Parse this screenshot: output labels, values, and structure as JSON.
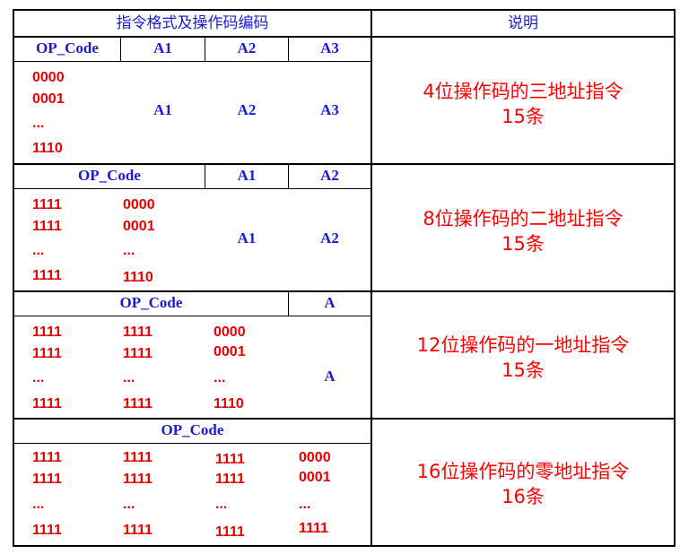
{
  "header": {
    "format_title": "指令格式及操作码编码",
    "desc_title": "说明"
  },
  "rows": [
    {
      "fields": [
        "OP_Code",
        "A1",
        "A2",
        "A3"
      ],
      "codes": [
        [
          "0000",
          "0001",
          "...",
          "1110"
        ]
      ],
      "addresses": [
        "A1",
        "A2",
        "A3"
      ],
      "desc": [
        "4位操作码的三地址指令",
        "15条"
      ]
    },
    {
      "fields": [
        "OP_Code",
        "A1",
        "A2"
      ],
      "codes": [
        [
          "1111",
          "1111",
          "...",
          "1111"
        ],
        [
          "0000",
          "0001",
          "...",
          "1110"
        ]
      ],
      "addresses": [
        "A1",
        "A2"
      ],
      "desc": [
        "8位操作码的二地址指令",
        "15条"
      ]
    },
    {
      "fields": [
        "OP_Code",
        "A"
      ],
      "codes": [
        [
          "1111",
          "1111",
          "...",
          "1111"
        ],
        [
          "1111",
          "1111",
          "...",
          "1111"
        ],
        [
          "0000",
          "0001",
          "...",
          "1110"
        ]
      ],
      "addresses": [
        "A"
      ],
      "desc": [
        "12位操作码的一地址指令",
        "15条"
      ]
    },
    {
      "fields": [
        "OP_Code"
      ],
      "codes": [
        [
          "1111",
          "1111",
          "...",
          "1111"
        ],
        [
          "1111",
          "1111",
          "...",
          "1111"
        ],
        [
          "1111",
          "1111",
          "...",
          "1111"
        ],
        [
          "0000",
          "0001",
          "...",
          "1111"
        ]
      ],
      "addresses": [],
      "desc": [
        "16位操作码的零地址指令",
        "16条"
      ]
    }
  ]
}
